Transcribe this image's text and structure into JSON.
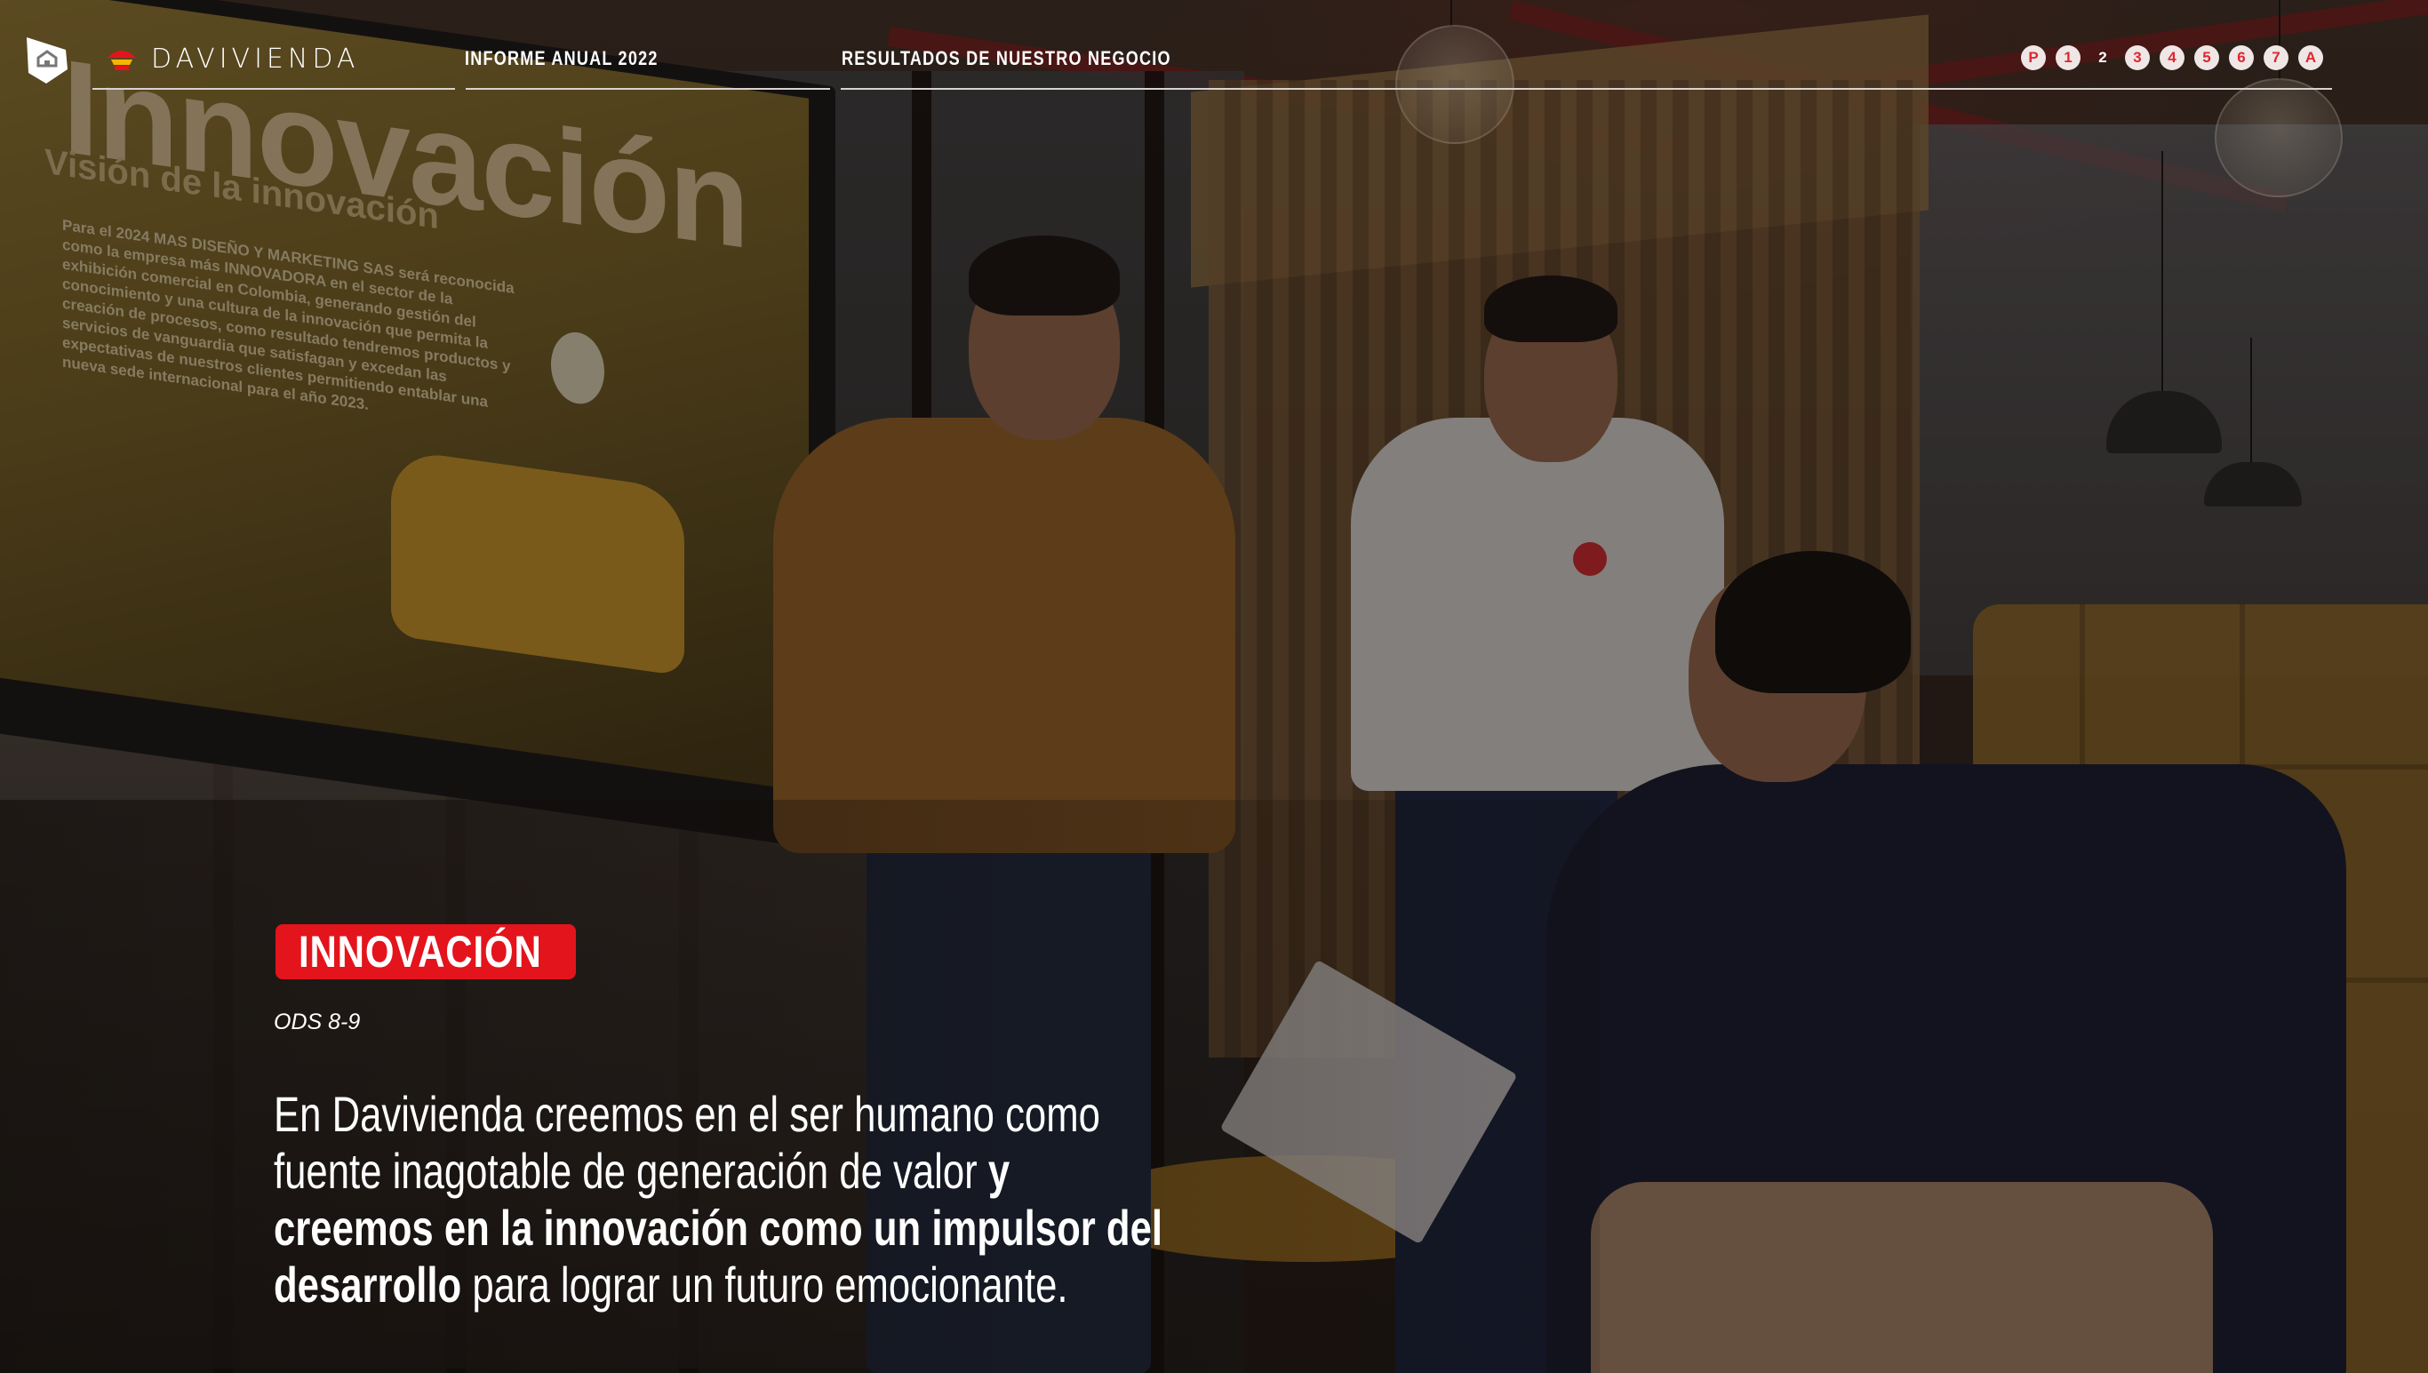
{
  "header": {
    "brand": "DAVIVIENDA",
    "breadcrumb_1": "INFORME ANUAL 2022",
    "breadcrumb_2": "RESULTADOS DE NUESTRO NEGOCIO",
    "pages": [
      "P",
      "1",
      "2",
      "3",
      "4",
      "5",
      "6",
      "7",
      "A"
    ],
    "active_page": "2"
  },
  "hero": {
    "section_tag": "INNOVACIÓN",
    "ods": "ODS 8-9",
    "lead_part1": "En Davivienda creemos en el ser humano como fuente inagotable de generación de valor ",
    "lead_bold": "y creemos en la innovación como un impulsor del desarrollo",
    "lead_part2": " para lograr un futuro emocionante."
  },
  "photo": {
    "screen_title": "Innovación",
    "screen_subtitle": "Visión de la innovación",
    "screen_body": "Para el 2024 MAS DISEÑO Y MARKETING SAS será reconocida como la empresa más INNOVADORA en el sector de la exhibición comercial en Colombia, generando gestión del conocimiento y una cultura de la innovación que permita la creación de procesos, como resultado tendremos productos y servicios de vanguardia que satisfagan y excedan las expectativas de nuestros clientes permitiendo entablar una nueva sede internacional para el año 2023."
  },
  "colors": {
    "accent_red": "#e3141c",
    "pager_bg": "#efe6e6",
    "text": "#ffffff"
  }
}
